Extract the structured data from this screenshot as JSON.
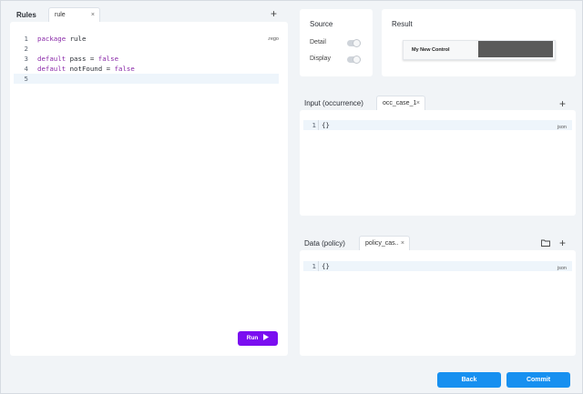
{
  "rules": {
    "title": "Rules",
    "tab_label": "rule",
    "tab_close": "×",
    "add_label": "+",
    "extension": ".rego",
    "lines": [
      {
        "num": "1",
        "kw": "package",
        "rest": " rule"
      },
      {
        "num": "2",
        "kw": "",
        "rest": ""
      },
      {
        "num": "3",
        "kw": "default",
        "rest": " pass = ",
        "kw2": "false"
      },
      {
        "num": "4",
        "kw": "default",
        "rest": " notFound = ",
        "kw2": "false"
      },
      {
        "num": "5",
        "kw": "",
        "rest": ""
      }
    ],
    "run_label": "Run"
  },
  "source": {
    "title": "Source",
    "detail_label": "Detail",
    "display_label": "Display"
  },
  "result": {
    "title": "Result",
    "control_label": "My New Control"
  },
  "input": {
    "title": "Input (occurrence)",
    "tab_label": "occ_case_1",
    "tab_close": "×",
    "add_label": "+",
    "line_num": "1",
    "content": "{}",
    "extension": "json"
  },
  "data": {
    "title": "Data (policy)",
    "tab_label": "policy_cas..",
    "tab_close": "×",
    "add_label": "+",
    "line_num": "1",
    "content": "{}",
    "extension": "json"
  },
  "footer": {
    "back_label": "Back",
    "commit_label": "Commit"
  },
  "colors": {
    "run_button": "#7a0ef0",
    "primary_button": "#1790f0",
    "keyword": "#8a2aa8"
  }
}
